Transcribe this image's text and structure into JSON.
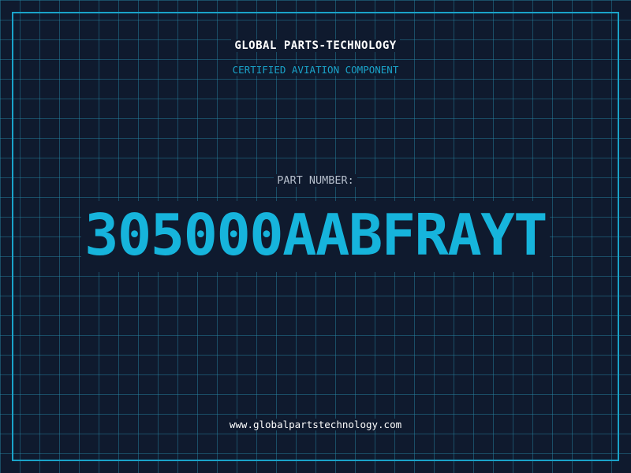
{
  "header": {
    "company_name": "GLOBAL PARTS-TECHNOLOGY",
    "subtitle": "CERTIFIED AVIATION COMPONENT"
  },
  "part": {
    "label": "PART NUMBER:",
    "number": "305000AABFRAYT"
  },
  "footer": {
    "website": "www.globalpartstechnology.com"
  },
  "colors": {
    "background": "#0f1a2e",
    "grid": "#288caa",
    "accent": "#1aa3c9",
    "part_number": "#16b4dc",
    "heading": "#ffffff",
    "label": "#b6bfcc"
  }
}
